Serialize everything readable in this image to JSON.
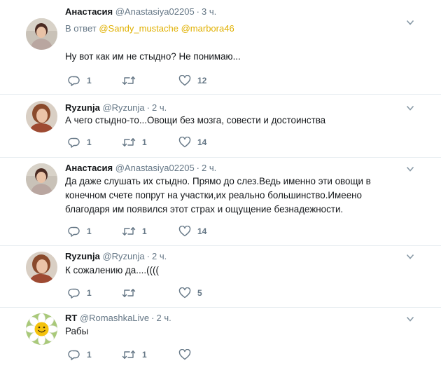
{
  "tweets": [
    {
      "name": "Анастасия",
      "handle": "@Anastasiya02205",
      "time": "3 ч.",
      "reply_prefix": "В ответ",
      "reply_mentions": [
        "@Sandy_mustache",
        "@marbora46"
      ],
      "text": "Ну вот как им не стыдно? Не понимаю...",
      "replies": "1",
      "retweets": "",
      "likes": "12"
    },
    {
      "name": "Ryzunja",
      "handle": "@Ryzunja",
      "time": "2 ч.",
      "text": "А чего стыдно-то...Овощи без мозга, совести и достоинства",
      "replies": "1",
      "retweets": "1",
      "likes": "14"
    },
    {
      "name": "Анастасия",
      "handle": "@Anastasiya02205",
      "time": "2 ч.",
      "text": "Да даже слушать их стыдно. Прямо до слез.Ведь именно эти овощи в\nконечном счете попрут на участки,их реально большинство.Имеено\nблагодаря им  появился этот страх и ощущение безнадежности.",
      "replies": "1",
      "retweets": "1",
      "likes": "14"
    },
    {
      "name": "Ryzunja",
      "handle": "@Ryzunja",
      "time": "2 ч.",
      "text": "К сожалению да....((((",
      "replies": "1",
      "retweets": "",
      "likes": "5"
    },
    {
      "name": "RT",
      "handle": "@RomashkaLive",
      "time": "2 ч.",
      "text": "Рабы",
      "replies": "1",
      "retweets": "1",
      "likes": ""
    }
  ],
  "colors": {
    "text": "#14171a",
    "secondary": "#657786",
    "mention": "#e0b000",
    "divider": "#e6ecf0"
  },
  "icons": {
    "reply": "reply-icon",
    "retweet": "retweet-icon",
    "like": "heart-icon",
    "more": "chevron-down-icon"
  }
}
